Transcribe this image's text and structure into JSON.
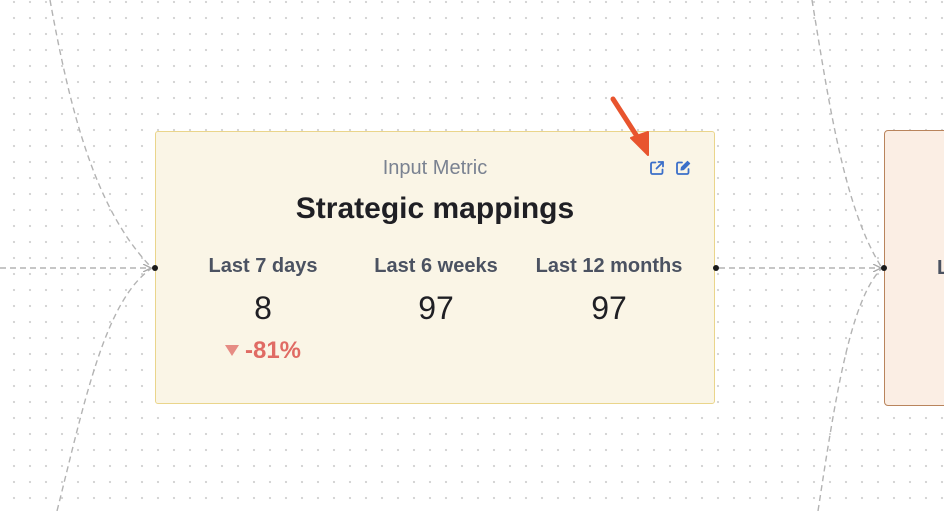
{
  "canvas": {
    "node": {
      "type_label": "Input Metric",
      "title": "Strategic mappings",
      "actions": {
        "open_icon": "external-link-icon",
        "edit_icon": "edit-icon"
      },
      "metrics": [
        {
          "label": "Last 7 days",
          "value": "8",
          "change": "-81%",
          "trend": "down"
        },
        {
          "label": "Last 6 weeks",
          "value": "97"
        },
        {
          "label": "Last 12 months",
          "value": "97"
        }
      ]
    },
    "next_node": {
      "partial_label": "L"
    }
  },
  "colors": {
    "node_background": "#faf5e6",
    "node_border": "#ead58b",
    "next_node_background": "#fbeee4",
    "next_node_border": "#b9845c",
    "negative_change": "#e06b64",
    "icon_accent": "#3b6fc9",
    "annotation_arrow": "#e8542e"
  }
}
